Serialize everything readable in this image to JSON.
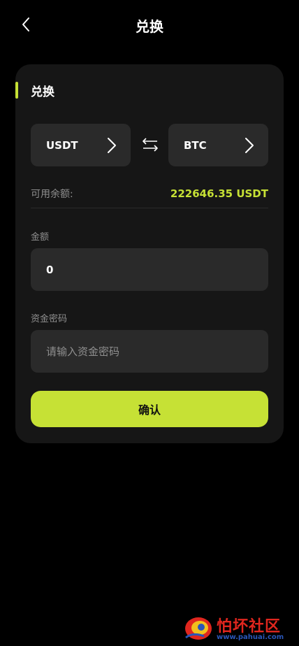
{
  "header": {
    "title": "兑换",
    "back_icon": "chevron-left-icon"
  },
  "card": {
    "section_title": "兑换",
    "from_coin": "USDT",
    "to_coin": "BTC",
    "swap_icon": "swap-arrows-icon",
    "balance_label": "可用余额:",
    "balance_value": "222646.35 USDT",
    "amount_label": "金额",
    "amount_value": "0",
    "password_label": "资金密码",
    "password_placeholder": "请输入资金密码",
    "confirm_label": "确认"
  },
  "watermark": {
    "brand": "怕坏社区",
    "url": "www.pahuai.com"
  },
  "colors": {
    "accent": "#c6e135",
    "background": "#000000",
    "card": "#161616",
    "field": "#2a2a2a",
    "muted_text": "#8f8f8f"
  }
}
